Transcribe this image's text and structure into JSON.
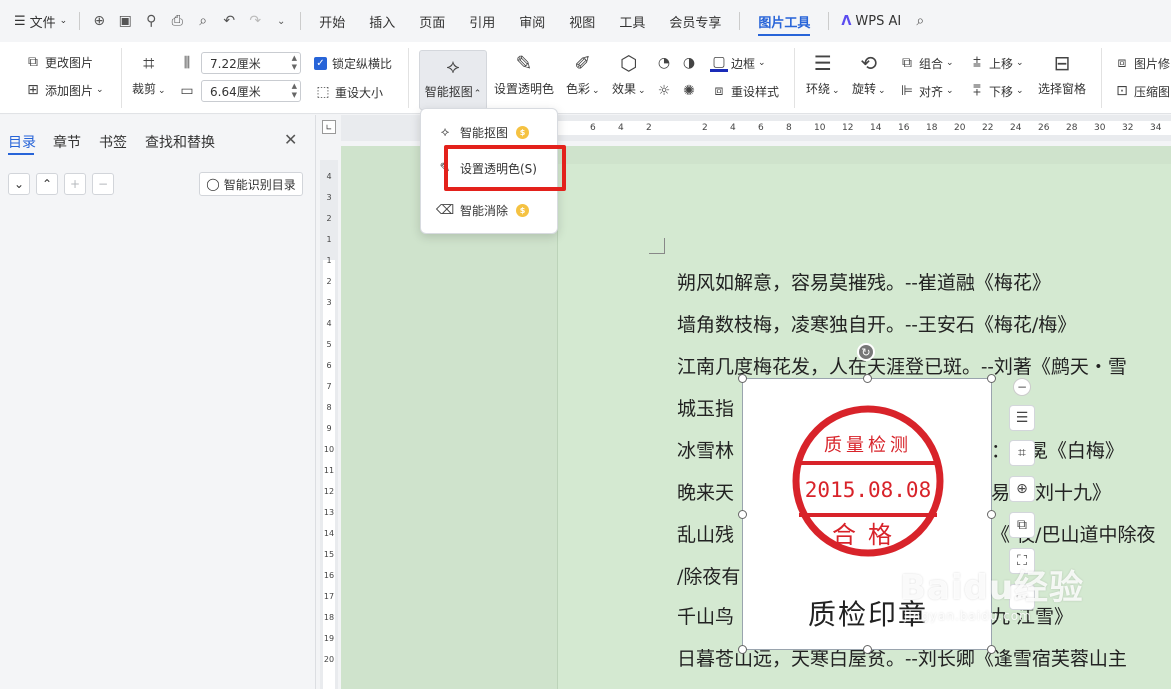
{
  "menubar": {
    "file_label": "文件",
    "tabs": [
      "开始",
      "插入",
      "页面",
      "引用",
      "审阅",
      "视图",
      "工具",
      "会员专享",
      "图片工具"
    ],
    "active_tab": "图片工具",
    "wps_ai_label": "WPS AI"
  },
  "ribbon": {
    "change_image": "更改图片",
    "add_image": "添加图片",
    "crop": "裁剪",
    "width_value": "7.22厘米",
    "height_value": "6.64厘米",
    "lock_ratio": "锁定纵横比",
    "reset_size": "重设大小",
    "smart_cutout": "智能抠图",
    "set_transparent": "设置透明色",
    "color": "色彩",
    "effects": "效果",
    "border": "边框",
    "reset_style": "重设样式",
    "wrap": "环绕",
    "rotate": "旋转",
    "group": "组合",
    "align": "对齐",
    "bring_forward": "上移",
    "send_backward": "下移",
    "selection_pane": "选择窗格",
    "image_repair": "图片修",
    "compress": "压缩图"
  },
  "left_panel": {
    "tabs": [
      "目录",
      "章节",
      "书签",
      "查找和替换"
    ],
    "smart_toc_button": "智能识别目录"
  },
  "dropdown": {
    "items": [
      {
        "label": "智能抠图",
        "premium": true
      },
      {
        "label": "设置透明色(S)",
        "premium": false
      },
      {
        "label": "智能消除",
        "premium": true
      }
    ]
  },
  "ruler": {
    "h_ticks": [
      "6",
      "4",
      "2",
      "2",
      "4",
      "6",
      "8",
      "10",
      "12",
      "14",
      "16",
      "18",
      "20",
      "22",
      "24",
      "26",
      "28",
      "30",
      "32",
      "34"
    ],
    "v_ticks": [
      "4",
      "3",
      "2",
      "1",
      "1",
      "2",
      "3",
      "4",
      "5",
      "6",
      "7",
      "8",
      "9",
      "10",
      "11",
      "12",
      "13",
      "14",
      "15",
      "16",
      "17",
      "18",
      "19",
      "20"
    ]
  },
  "document": {
    "lines": [
      "朔风如解意，容易莫摧残。--崔道融《梅花》",
      "墙角数枝梅，凌寒独自开。--王安石《梅花/梅》",
      "江南几度梅花发，人在天涯登已斑。--刘著《鹧天・雪",
      "城玉指",
      "冰雪林",
      "晚来天",
      "乱山残",
      "/除夜有",
      "千山鸟",
      "日暮苍山远，天寒白屋贫。--刘长卿《逢雪宿芙蓉山主"
    ],
    "right_fragments": [
      {
        "text": "：-- 冕《白梅》"
      },
      {
        "text": "易  问刘十九》"
      },
      {
        "text": "《  夜/巴山道中除夜"
      },
      {
        "text": "九 江雪》"
      }
    ]
  },
  "stamp": {
    "top_text": "质量检测",
    "date": "2015.08.08",
    "bottom_text": "合格",
    "caption": "质检印章",
    "color": "#d8232a"
  },
  "watermark": {
    "big": "Baidu经验",
    "small": "jingyan.baidu.com"
  }
}
